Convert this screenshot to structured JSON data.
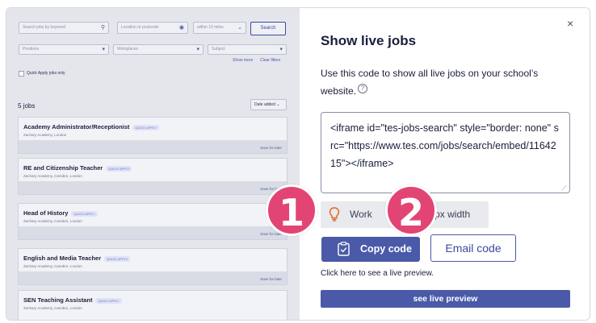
{
  "search": {
    "keyword_placeholder": "Search jobs by keyword",
    "location_placeholder": "Location or postcode",
    "radius": "within 10 miles",
    "search_label": "Search",
    "positions": "Positions",
    "workplaces": "Workplaces",
    "subject": "Subject",
    "show_more": "Show more",
    "clear_filters": "Clear filters",
    "quick_apply_only": "Quick Apply jobs only"
  },
  "results": {
    "count": "5 jobs",
    "sort": "Date added",
    "jobs": [
      {
        "title": "Academy Administrator/Receptionist",
        "badge": "QUICK APPLY",
        "school": "Zachary Academy, London",
        "save": "Save for later"
      },
      {
        "title": "RE and Citizenship Teacher",
        "badge": "QUICK APPLY",
        "school": "Zachary Academy, Camden, London",
        "save": "Save for later"
      },
      {
        "title": "Head of History",
        "badge": "QUICK APPLY",
        "school": "Zachary Academy, Camden, London",
        "save": "Save for later"
      },
      {
        "title": "English and Media Teacher",
        "badge": "QUICK APPLY",
        "school": "Zachary Academy, Camden, London",
        "save": "Save for later"
      },
      {
        "title": "SEN Teaching Assistant",
        "badge": "QUICK APPLY",
        "school": "Zachary Academy, Camden, London",
        "save": ""
      }
    ]
  },
  "markers": {
    "one": "1",
    "two": "2"
  },
  "panel": {
    "close": "×",
    "title": "Show live jobs",
    "description": "Use this code to show all live jobs on your school’s website.",
    "help": "?",
    "code": "<iframe id=\"tes-jobs-search\" style=\"border: none\" src=\"https://www.tes.com/jobs/search/embed/1164215\"></iframe>",
    "tip_left": "Work",
    "tip_right": "00px width",
    "copy_label": "Copy code",
    "email_label": "Email code",
    "preview_hint": "Click here to see a live preview.",
    "preview_label": "see live preview"
  }
}
